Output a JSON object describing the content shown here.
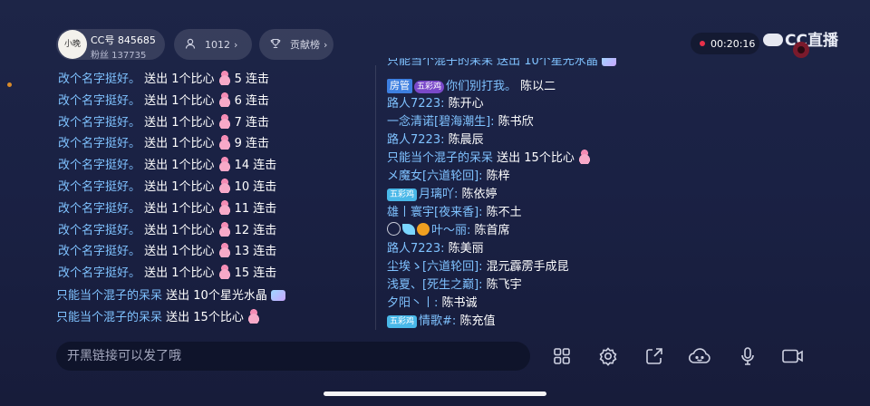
{
  "header": {
    "avatar_text": "小晚",
    "cc_id": "CC号 845685",
    "fans": "粉丝 137735",
    "viewers": "1012",
    "contribution": "贡献榜",
    "timer": "00:20:16",
    "logo": "CC直播"
  },
  "left_chat": [
    {
      "nick": "改个名字挺好。",
      "msg": "送出 1个比心",
      "combo": "5 连击"
    },
    {
      "nick": "改个名字挺好。",
      "msg": "送出 1个比心",
      "combo": "6 连击"
    },
    {
      "nick": "改个名字挺好。",
      "msg": "送出 1个比心",
      "combo": "7 连击"
    },
    {
      "nick": "改个名字挺好。",
      "msg": "送出 1个比心",
      "combo": "9 连击"
    },
    {
      "nick": "改个名字挺好。",
      "msg": "送出 1个比心",
      "combo": "14 连击"
    },
    {
      "nick": "改个名字挺好。",
      "msg": "送出 1个比心",
      "combo": "10 连击"
    },
    {
      "nick": "改个名字挺好。",
      "msg": "送出 1个比心",
      "combo": "11 连击"
    },
    {
      "nick": "改个名字挺好。",
      "msg": "送出 1个比心",
      "combo": "12 连击"
    },
    {
      "nick": "改个名字挺好。",
      "msg": "送出 1个比心",
      "combo": "13 连击"
    },
    {
      "nick": "改个名字挺好。",
      "msg": "送出 1个比心",
      "combo": "15 连击"
    }
  ],
  "left_chat_extra": [
    {
      "nick": "只能当个混子的呆呆",
      "msg": "送出 10个星光水晶"
    },
    {
      "nick": "只能当个混子的呆呆",
      "msg": "送出 15个比心"
    }
  ],
  "right_chat": {
    "partial_top": "只能当个混子的呆呆 送出 10个星光水晶",
    "admin_badge": "房管",
    "five_badge": "五彩鸡",
    "admin_msg": "你们别打我。",
    "admin_name": "陈以二",
    "lines": [
      {
        "nick": "路人7223:",
        "msg": "陈开心"
      },
      {
        "nick": "一念清诺[碧海潮生]:",
        "msg": "陈书欣"
      },
      {
        "nick": "路人7223:",
        "msg": "陈晨辰"
      }
    ],
    "gift_line": {
      "nick": "只能当个混子的呆呆",
      "msg": "送出 15个比心"
    },
    "lines2": [
      {
        "nick": "メ魔女[六道轮回]:",
        "msg": "陈梓"
      }
    ],
    "yueli": {
      "badge": "五彩鸡",
      "nick": "月璃吖:",
      "msg": "陈依婷"
    },
    "lines3": [
      {
        "nick": "雄丨寰宇[夜来香]:",
        "msg": "陈不土"
      }
    ],
    "yeli": {
      "nick": "叶～丽:",
      "msg": "陈首席"
    },
    "lines4": [
      {
        "nick": "路人7223:",
        "msg": "陈美丽"
      },
      {
        "nick": "尘埃ゝ[六道轮回]:",
        "msg": "混元霹雳手成昆"
      },
      {
        "nick": "浅夏、[死生之巅]:",
        "msg": "陈飞宇"
      },
      {
        "nick": "夕阳丶丨:",
        "msg": "陈书诚"
      }
    ],
    "last": {
      "badge": "五彩鸡",
      "nick": "情歌#:",
      "msg": "陈充值"
    }
  },
  "input": {
    "placeholder": "开黑链接可以发了哦"
  }
}
